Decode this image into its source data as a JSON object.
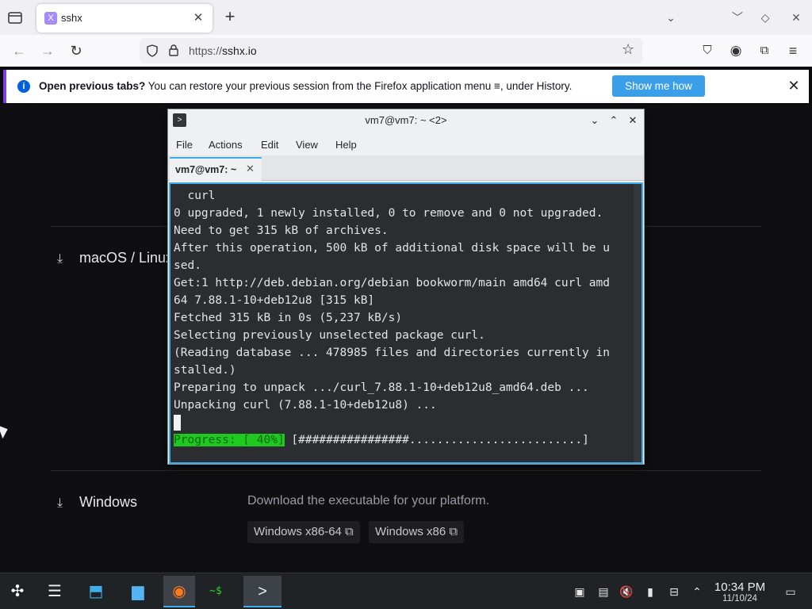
{
  "browser": {
    "tab_title": "sshx",
    "tab_favicon": "sshx-favicon",
    "url_prefix": "https://",
    "url_host": "sshx.io",
    "infobar": {
      "bold": "Open previous tabs?",
      "text": " You can restore your previous session from the Firefox application menu ≡, under History.",
      "button": "Show me how"
    }
  },
  "page": {
    "sections": [
      {
        "heading": "macOS / Linux"
      },
      {
        "heading": "Windows",
        "description": "Download the executable for your platform."
      }
    ],
    "windows_links": [
      "Windows x86-64 ⧉",
      "Windows x86 ⧉"
    ]
  },
  "konsole": {
    "title": "vm7@vm7: ~ <2>",
    "menus": [
      "File",
      "Actions",
      "Edit",
      "View",
      "Help"
    ],
    "tab_label": "vm7@vm7: ~",
    "lines": [
      "  curl",
      "0 upgraded, 1 newly installed, 0 to remove and 0 not upgraded.",
      "Need to get 315 kB of archives.",
      "After this operation, 500 kB of additional disk space will be u",
      "sed.",
      "Get:1 http://deb.debian.org/debian bookworm/main amd64 curl amd",
      "64 7.88.1-10+deb12u8 [315 kB]",
      "Fetched 315 kB in 0s (5,237 kB/s)",
      "Selecting previously unselected package curl.",
      "(Reading database ... 478985 files and directories currently in",
      "stalled.)",
      "Preparing to unpack .../curl_7.88.1-10+deb12u8_amd64.deb ...",
      "Unpacking curl (7.88.1-10+deb12u8) ..."
    ],
    "progress_label": "Progress: [ 40%]",
    "progress_bar": " [################.........................]",
    "progress_fraction": 0.4
  },
  "taskbar": {
    "time": "10:34 PM",
    "date": "11/10/24"
  }
}
